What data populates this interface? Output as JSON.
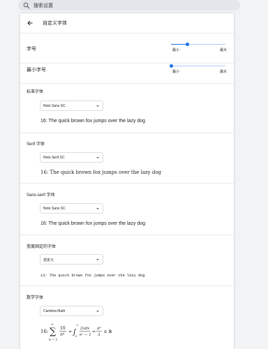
{
  "search": {
    "placeholder": "搜索设置"
  },
  "header": {
    "title": "自定义字体"
  },
  "sliders": {
    "font_size": {
      "label": "字号",
      "min_label": "最小",
      "max_label": "最大",
      "level": 0.3
    },
    "min_font_size": {
      "label": "最小字号",
      "min_label": "最小",
      "max_label": "最大",
      "level": 0.0
    }
  },
  "sections": {
    "standard": {
      "label": "标准字体",
      "font": "Noto Sans SC",
      "sample": "16: The quick brown fox jumps over the lazy dog"
    },
    "serif": {
      "label": "Serif 字体",
      "font": "Noto Serif SC",
      "sample": "16: The quick brown fox jumps over the lazy dog"
    },
    "sans": {
      "label": "Sans-serif 字体",
      "font": "Noto Sans SC",
      "sample": "16: The quick brown fox jumps over the lazy dog"
    },
    "fixed": {
      "label": "宽度固定的字体",
      "font": "自定义",
      "sample": "13: The quick brown fox jumps over the lazy dog"
    },
    "math": {
      "label": "数学字体",
      "font": "Cambria Math",
      "prefix": "16:"
    }
  },
  "colors": {
    "accent": "#1a73e8",
    "track": "#aecbfa"
  },
  "icons": {
    "search": "search-icon",
    "back": "arrow-back-icon",
    "dropdown": "caret-down-icon"
  }
}
